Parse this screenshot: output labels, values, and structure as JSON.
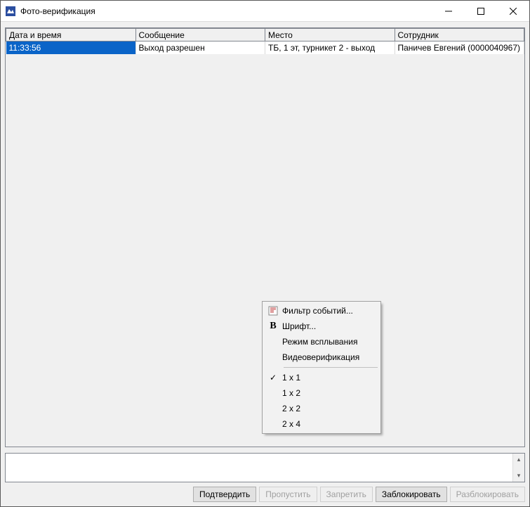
{
  "window": {
    "title": "Фото-верификация"
  },
  "table": {
    "headers": [
      "Дата и время",
      "Сообщение",
      "Место",
      "Сотрудник"
    ],
    "col_widths": [
      "25%",
      "25%",
      "25%",
      "25%"
    ],
    "rows": [
      {
        "cells": [
          "11:33:56",
          "Выход разрешен",
          "ТБ, 1 эт, турникет 2 - выход",
          "Паничев Евгений (0000040967)"
        ],
        "selected": true
      }
    ]
  },
  "context_menu": {
    "group1": [
      {
        "icon": "filter",
        "label": "Фильтр событий..."
      },
      {
        "icon": "bold",
        "label": "Шрифт..."
      },
      {
        "icon": "",
        "label": "Режим всплывания"
      },
      {
        "icon": "",
        "label": "Видеоверификация"
      }
    ],
    "group2": [
      {
        "checked": true,
        "label": "1 x 1"
      },
      {
        "checked": false,
        "label": "1 x 2"
      },
      {
        "checked": false,
        "label": "2 x 2"
      },
      {
        "checked": false,
        "label": "2 x 4"
      }
    ]
  },
  "memo": {
    "text": ""
  },
  "buttons": {
    "confirm": {
      "label": "Подтвердить",
      "enabled": true
    },
    "skip": {
      "label": "Пропустить",
      "enabled": false
    },
    "deny": {
      "label": "Запретить",
      "enabled": false
    },
    "block": {
      "label": "Заблокировать",
      "enabled": true
    },
    "unblock": {
      "label": "Разблокировать",
      "enabled": false
    }
  }
}
